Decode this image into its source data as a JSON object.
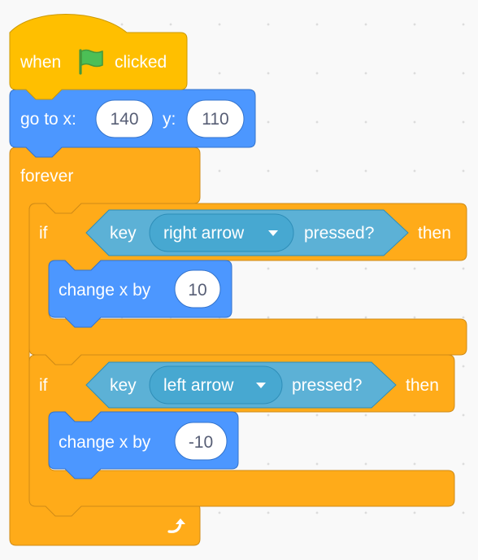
{
  "colors": {
    "events": "#ffbf00",
    "events_border": "#cc9900",
    "motion": "#4c97ff",
    "motion_border": "#3373cc",
    "control": "#ffab19",
    "control_border": "#cf8b17",
    "sensing": "#5cb1d6",
    "sensing_border": "#2e8eb8",
    "sensing_menu": "#47a8d1",
    "input_bg": "#ffffff",
    "input_text": "#575e75",
    "flag": "#4cbf56",
    "flag_border": "#45993d"
  },
  "script": {
    "hat": {
      "when_label": "when",
      "flag_icon": "green-flag-icon",
      "clicked_label": "clicked"
    },
    "goto": {
      "label": "go to x:",
      "x_value": "140",
      "y_label": "y:",
      "y_value": "110"
    },
    "forever": {
      "label": "forever",
      "loop_icon": "loop-arrow-icon"
    },
    "if_right": {
      "if_label": "if",
      "key_label": "key",
      "key_option": "right arrow",
      "pressed_label": "pressed?",
      "then_label": "then",
      "change_label": "change x by",
      "change_value": "10"
    },
    "if_left": {
      "if_label": "if",
      "key_label": "key",
      "key_option": "left arrow",
      "pressed_label": "pressed?",
      "then_label": "then",
      "change_label": "change x by",
      "change_value": "-10"
    }
  }
}
